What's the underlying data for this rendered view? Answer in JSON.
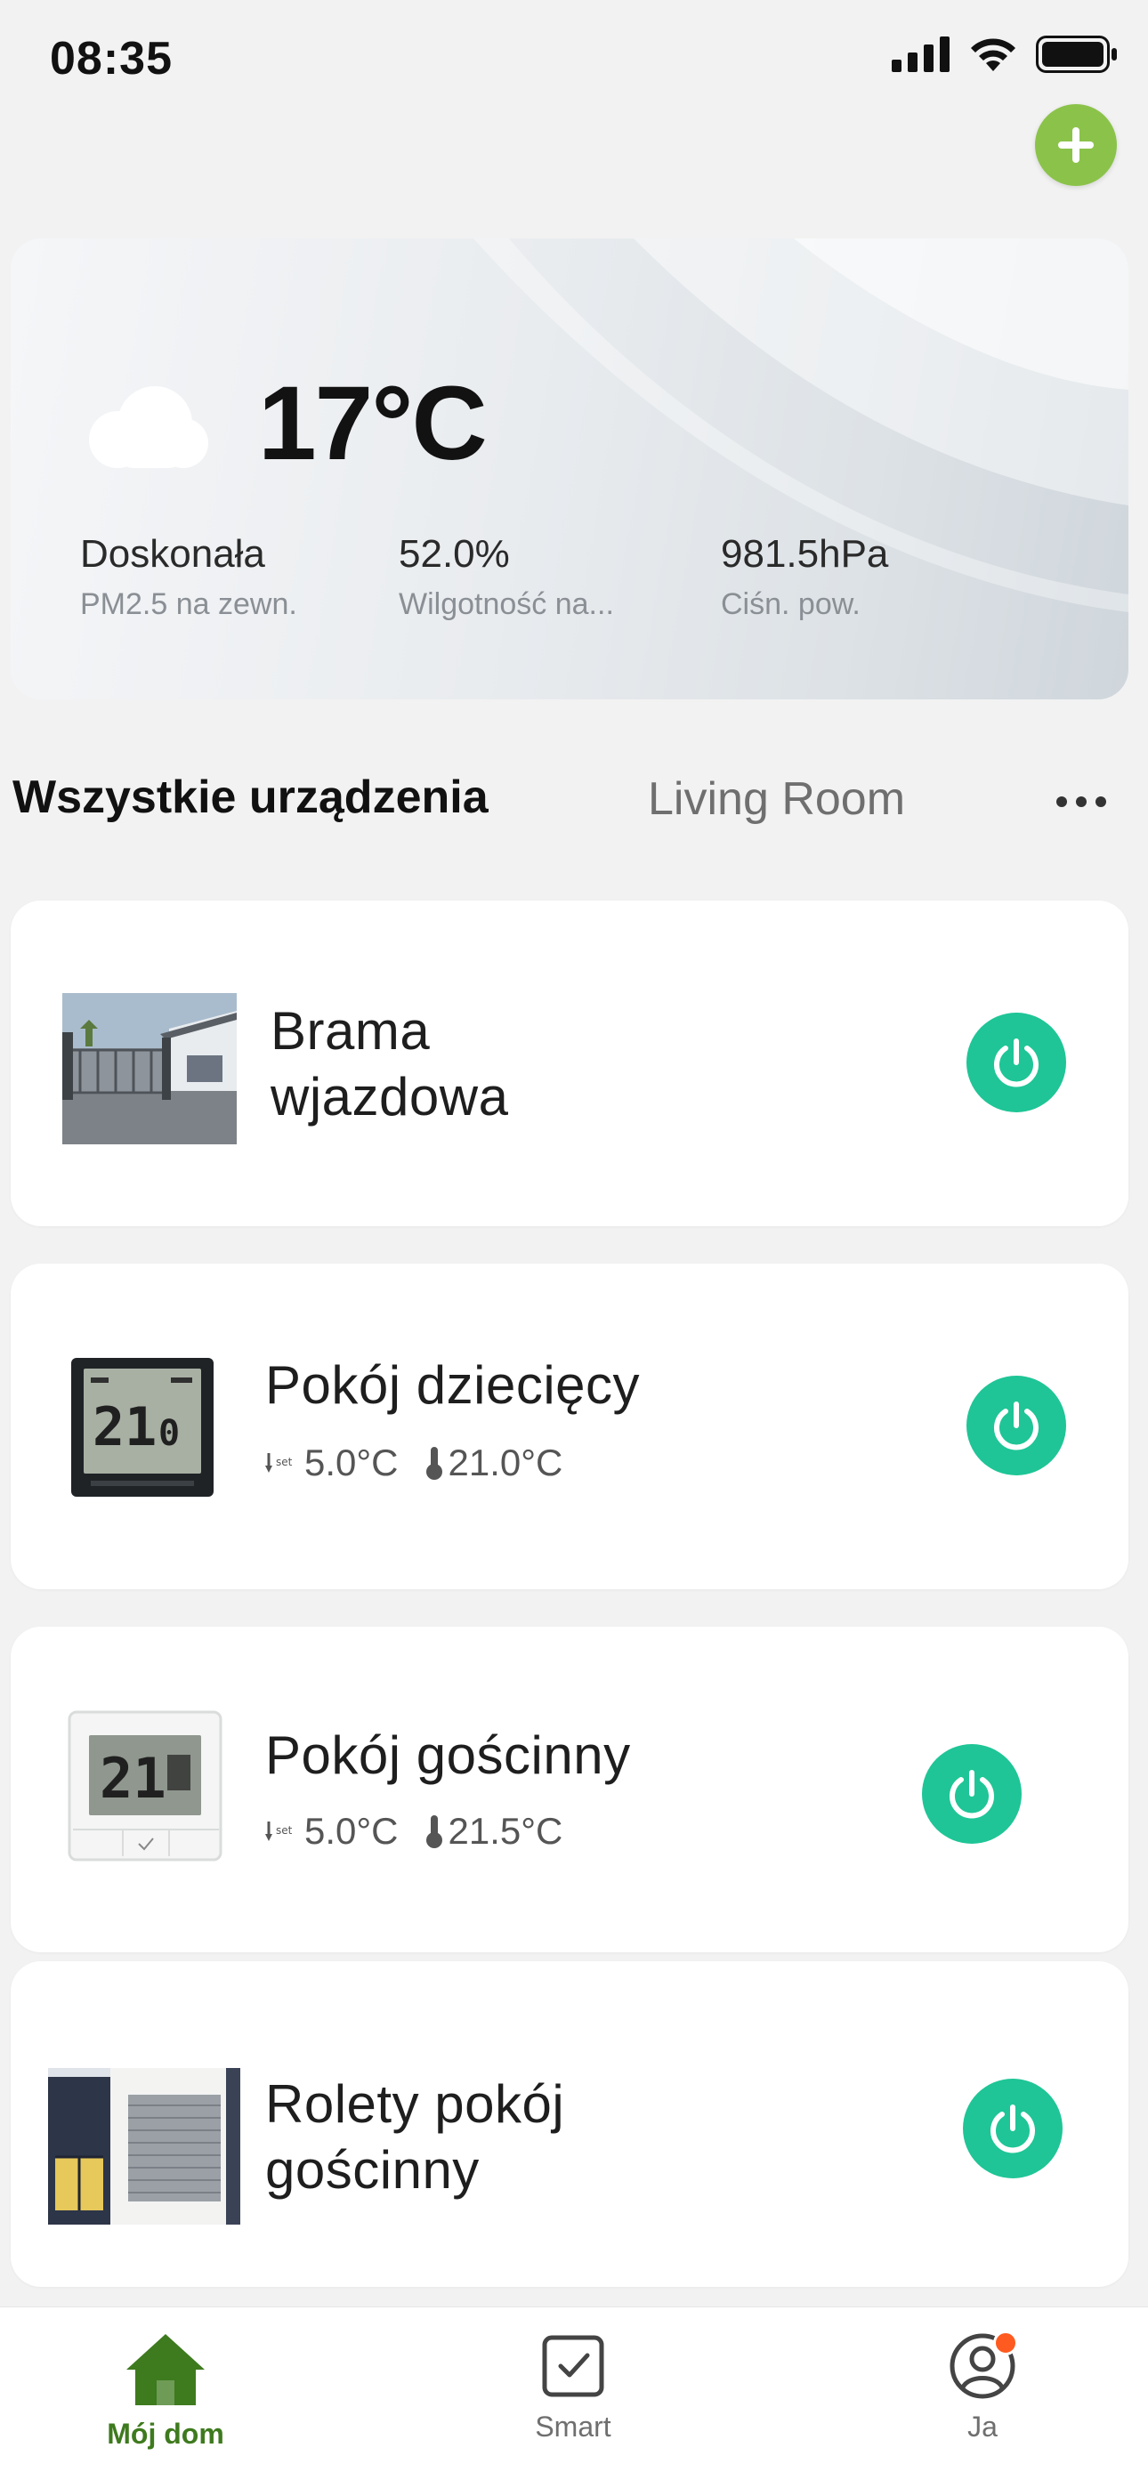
{
  "status_bar": {
    "time": "08:35"
  },
  "colors": {
    "accent_green": "#8bc34a",
    "power_green": "#1fc596",
    "nav_active": "#3e7a1e",
    "badge_orange": "#ff5a1f"
  },
  "header": {
    "add_icon": "plus-icon"
  },
  "weather": {
    "icon": "cloud-icon",
    "temperature": "17°C",
    "stats": [
      {
        "value": "Doskonała",
        "label": "PM2.5 na zewn."
      },
      {
        "value": "52.0%",
        "label": "Wilgotność na..."
      },
      {
        "value": "981.5hPa",
        "label": "Ciśn. pow."
      }
    ]
  },
  "tabs": {
    "all": "Wszystkie urządzenia",
    "living_room": "Living Room",
    "more_icon": "more-dots-icon"
  },
  "devices": [
    {
      "name_line1": "Brama",
      "name_line2": "wjazdowa",
      "thumb": "gate-photo"
    },
    {
      "name_line1": "Pokój dziecięcy",
      "set_temp": "5.0°C",
      "current_temp": "21.0°C",
      "thumb": "thermostat-black"
    },
    {
      "name_line1": "Pokój gościnny",
      "set_temp": "5.0°C",
      "current_temp": "21.5°C",
      "thumb": "thermostat-white"
    },
    {
      "name_line1": "Rolety pokój",
      "name_line2": "gościnny",
      "thumb": "shutter-photo"
    }
  ],
  "bottom_nav": {
    "items": [
      {
        "label": "Mój dom",
        "icon": "home-icon",
        "active": true
      },
      {
        "label": "Smart",
        "icon": "smart-checkbox-icon",
        "active": false
      },
      {
        "label": "Ja",
        "icon": "profile-icon",
        "active": false
      }
    ]
  }
}
